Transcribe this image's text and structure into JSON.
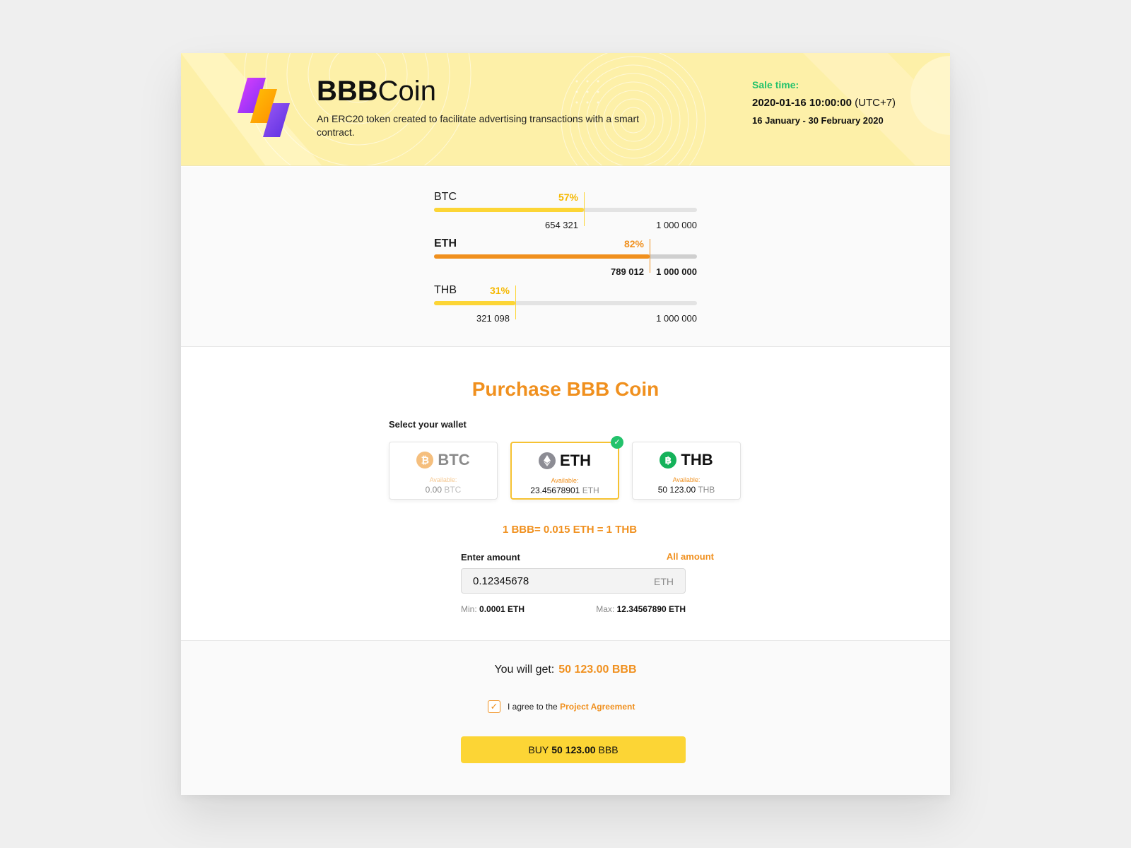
{
  "header": {
    "title_bold": "BBB",
    "title_rest": "Coin",
    "description": "An ERC20 token created to facilitate advertising transactions with a smart contract.",
    "sale_label": "Sale time:",
    "sale_datetime": "2020-01-16 10:00:00",
    "sale_timezone": "(UTC+7)",
    "sale_range": "16 January - 30 February 2020"
  },
  "progress": [
    {
      "name": "BTC",
      "percent": "57%",
      "fraction": 0.57,
      "raised": "654 321",
      "goal": "1 000 000",
      "active": false
    },
    {
      "name": "ETH",
      "percent": "82%",
      "fraction": 0.82,
      "raised": "789 012",
      "goal": "1 000 000",
      "active": true
    },
    {
      "name": "THB",
      "percent": "31%",
      "fraction": 0.31,
      "raised": "321 098",
      "goal": "1 000 000",
      "active": false
    }
  ],
  "purchase": {
    "title": "Purchase BBB Coin",
    "wallet_label": "Select your wallet",
    "wallets": [
      {
        "name": "BTC",
        "icon": "bitcoin-icon",
        "available_label": "Available:",
        "balance": "0.00",
        "unit": "BTC",
        "state": "disabled"
      },
      {
        "name": "ETH",
        "icon": "ethereum-icon",
        "available_label": "Available:",
        "balance": "23.45678901",
        "unit": "ETH",
        "state": "selected"
      },
      {
        "name": "THB",
        "icon": "baht-icon",
        "available_label": "Available:",
        "balance": "50 123.00",
        "unit": "THB",
        "state": "normal"
      }
    ],
    "rate": "1 BBB= 0.015 ETH = 1 THB",
    "amount_label": "Enter amount",
    "all_amount": "All amount",
    "amount_value": "0.12345678",
    "amount_unit": "ETH",
    "min_label": "Min:",
    "min_value": "0.0001 ETH",
    "max_label": "Max:",
    "max_value": "12.34567890 ETH"
  },
  "summary": {
    "get_label": "You will get:",
    "get_amount": "50 123.00 BBB",
    "agree_text": "I agree to the",
    "agree_link": "Project Agreement",
    "agree_checked": true,
    "buy_prefix": "BUY",
    "buy_amount": "50 123.00",
    "buy_suffix": "BBB"
  },
  "colors": {
    "accent_orange": "#f0901e",
    "accent_yellow": "#fcd535",
    "banner_bg": "#fdf0a8",
    "success_green": "#23c26b",
    "bitcoin": "#f5bf7e",
    "ethereum": "#8c8c94",
    "baht": "#14b25a"
  }
}
